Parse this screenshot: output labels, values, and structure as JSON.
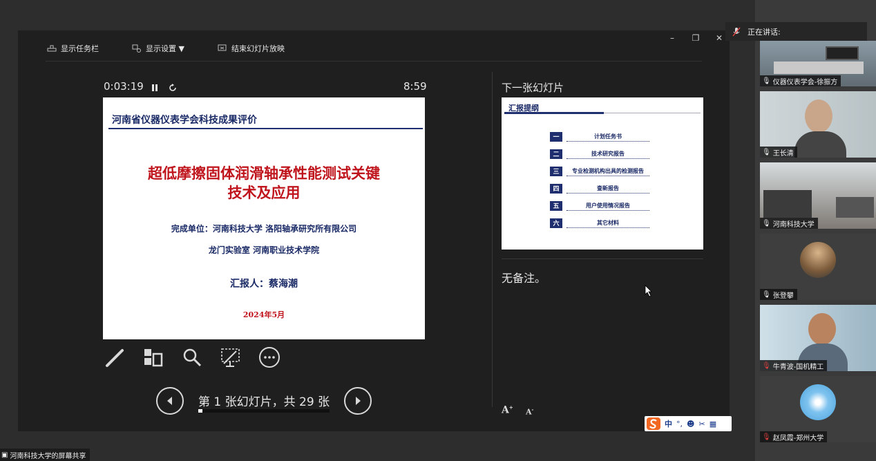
{
  "toolbar": {
    "show_taskbar": "显示任务栏",
    "display_settings": "显示设置 ▼",
    "end_slideshow": "结束幻灯片放映"
  },
  "window_controls": {
    "minimize": "–",
    "restore": "❐",
    "close": "✕"
  },
  "timer": {
    "elapsed": "0:03:19",
    "clock": "8:59"
  },
  "current_slide": {
    "header": "河南省仪器仪表学会科技成果评价",
    "title_line1": "超低摩擦固体润滑轴承性能测试关键",
    "title_line2": "技术及应用",
    "unit_line1": "完成单位：河南科技大学 洛阳轴承研究所有限公司",
    "unit_line2": "龙门实验室   河南职业技术学院",
    "presenter": "汇报人：蔡海潮",
    "date": "2024年5月"
  },
  "navigation": {
    "counter": "第 1 张幻灯片，共 29 张",
    "progress": 0.034
  },
  "next_slide": {
    "label": "下一张幻灯片",
    "header": "汇报提纲",
    "items": [
      {
        "num": "一",
        "text": "计划任务书"
      },
      {
        "num": "二",
        "text": "技术研究报告"
      },
      {
        "num": "三",
        "text": "专业检测机构出具的检测报告"
      },
      {
        "num": "四",
        "text": "查新报告"
      },
      {
        "num": "五",
        "text": "用户使用情况报告"
      },
      {
        "num": "六",
        "text": "其它材料"
      }
    ]
  },
  "notes": {
    "text": "无备注。"
  },
  "font_controls": {
    "increase": "A",
    "decrease": "A"
  },
  "ime": {
    "lang": "中"
  },
  "meeting": {
    "speaking_label": "正在讲话:",
    "participants": [
      {
        "name": "仪器仪表学会-徐振方"
      },
      {
        "name": "王长清"
      },
      {
        "name": "河南科技大学"
      },
      {
        "name": "张登攀"
      },
      {
        "name": "牛青波-国机精工"
      },
      {
        "name": "赵凤霞-郑州大学"
      }
    ],
    "share_label": "河南科技大学的屏幕共享"
  },
  "colors": {
    "accent_blue": "#1f2e6e",
    "title_red": "#c0141c"
  }
}
